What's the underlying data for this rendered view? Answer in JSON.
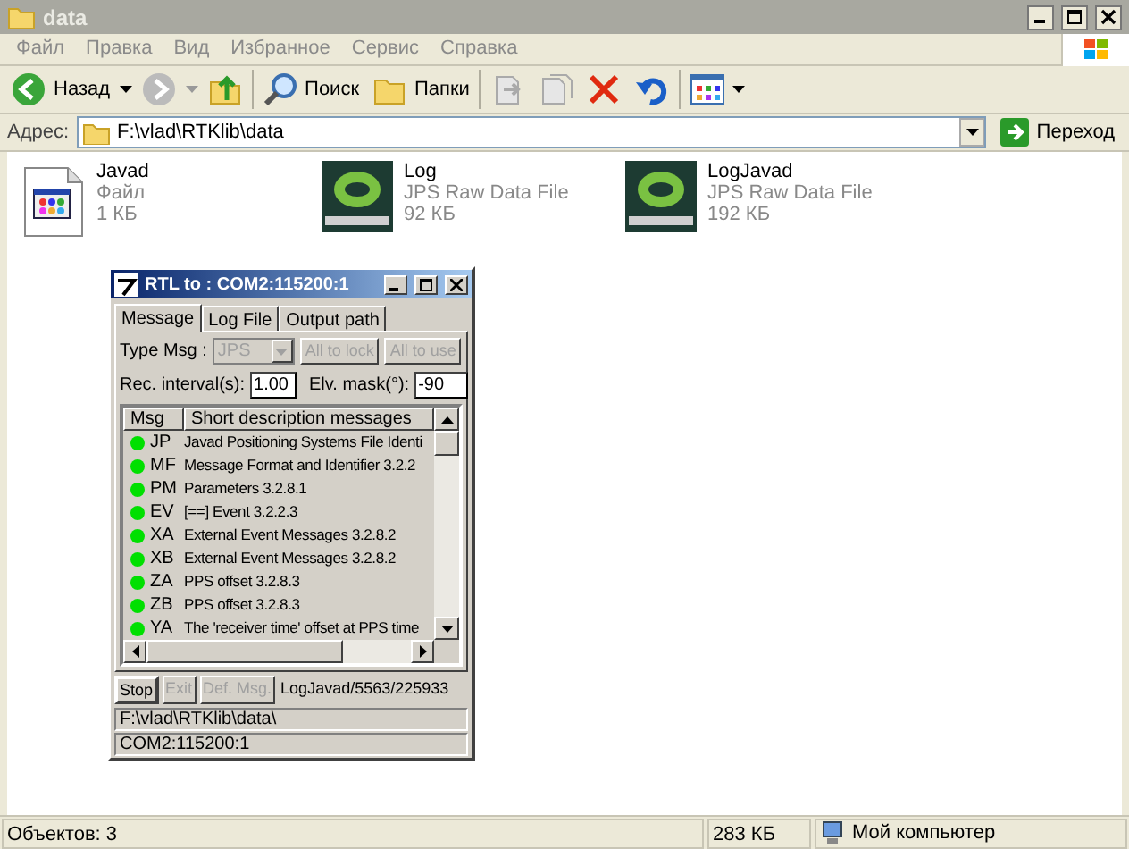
{
  "window": {
    "title": "data",
    "active": false
  },
  "menu": [
    "Файл",
    "Правка",
    "Вид",
    "Избранное",
    "Сервис",
    "Справка"
  ],
  "toolbar": {
    "back": "Назад",
    "search": "Поиск",
    "folders": "Папки"
  },
  "address": {
    "label": "Адрес:",
    "value": "F:\\vlad\\RTKlib\\data",
    "go": "Переход"
  },
  "files": [
    {
      "kind": "exe",
      "name": "Javad",
      "type": "Файл",
      "size": "1 КБ"
    },
    {
      "kind": "jps",
      "name": "Log",
      "type": "JPS Raw Data File",
      "size": "92 КБ"
    },
    {
      "kind": "jps",
      "name": "LogJavad",
      "type": "JPS Raw Data File",
      "size": "192 КБ"
    }
  ],
  "dialog": {
    "title": "RTL to : COM2:115200:1",
    "tabs": [
      {
        "label": "Message",
        "selected": true
      },
      {
        "label": "Log File",
        "selected": false
      },
      {
        "label": "Output path",
        "selected": false
      }
    ],
    "type_msg": {
      "label": "Type Msg :",
      "value": "JPS",
      "disabled": true
    },
    "all_to_lock": {
      "label": "All to lock",
      "disabled": true
    },
    "all_to_use": {
      "label": "All to use",
      "disabled": true
    },
    "rec_interval": {
      "label": "Rec. interval(s):",
      "value": "1.00"
    },
    "elv_mask": {
      "label": "Elv. mask(°):",
      "value": "-90"
    },
    "columns": [
      "Msg",
      "Short description messages"
    ],
    "rows": [
      {
        "msg": "JP",
        "desc": "Javad Positioning Systems File Identi",
        "color": "#00e000"
      },
      {
        "msg": "MF",
        "desc": "Message Format and Identifier 3.2.2",
        "color": "#00e000"
      },
      {
        "msg": "PM",
        "desc": "Parameters 3.2.8.1",
        "color": "#00e000"
      },
      {
        "msg": "EV",
        "desc": "[==] Event 3.2.2.3",
        "color": "#00e000"
      },
      {
        "msg": "XA",
        "desc": "External Event Messages 3.2.8.2",
        "color": "#00e000"
      },
      {
        "msg": "XB",
        "desc": "External Event Messages 3.2.8.2",
        "color": "#00e000"
      },
      {
        "msg": "ZA",
        "desc": "PPS offset 3.2.8.3",
        "color": "#00e000"
      },
      {
        "msg": "ZB",
        "desc": "PPS offset 3.2.8.3",
        "color": "#00e000"
      },
      {
        "msg": "YA",
        "desc": "The 'receiver time' offset at PPS time",
        "color": "#00e000"
      }
    ],
    "buttons": [
      {
        "label": "Stop",
        "disabled": false
      },
      {
        "label": "Exit",
        "disabled": true
      },
      {
        "label": "Def. Msg.",
        "disabled": true
      }
    ],
    "progress": "LogJavad/5563/225933",
    "status": [
      "F:\\vlad\\RTKlib\\data\\",
      "COM2:115200:1"
    ]
  },
  "status_bar": {
    "objects": "Объектов: 3",
    "size": "283 КБ",
    "zone": "Мой компьютер"
  }
}
